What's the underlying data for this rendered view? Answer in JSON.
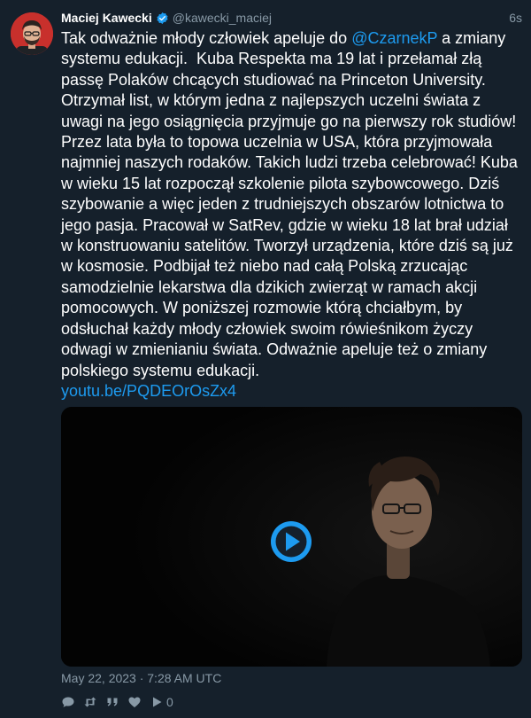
{
  "author": {
    "display_name": "Maciej Kawecki",
    "handle": "@kawecki_maciej",
    "time_ago": "6s",
    "verified": true
  },
  "tweet": {
    "text_before_mention": "Tak odważnie młody człowiek apeluje do ",
    "mention": "@CzarnekP",
    "text_after_mention": " a zmiany systemu edukacji.  Kuba Respekta ma 19 lat i przełamał złą passę Polaków chcących studiować na Princeton University. Otrzymał list, w którym jedna z najlepszych uczelni świata z uwagi na jego osiągnięcia przyjmuje go na pierwszy rok studiów! Przez lata była to topowa uczelnia w USA, która przyjmowała najmniej naszych rodaków. Takich ludzi trzeba celebrować! Kuba w wieku 15 lat rozpoczął szkolenie pilota szybowcowego. Dziś szybowanie a więc jeden z trudniejszych obszarów lotnictwa to jego pasja. Pracował w SatRev, gdzie w wieku 18 lat brał udział w konstruowaniu satelitów. Tworzył urządzenia, które dziś są już w kosmosie. Podbijał też niebo nad całą Polską zrzucając samodzielnie lekarstwa dla dzikich zwierząt w ramach akcji pomocowych. W poniższej rozmowie którą chciałbym, by odsłuchał każdy młody człowiek swoim rówieśnikom życzy odwagi w zmienianiu świata. Odważnie apeluje też o zmiany polskiego systemu edukacji.\n",
    "link": "youtu.be/PQDEOrOsZx4"
  },
  "date": "May 22, 2023 · 7:28 AM UTC",
  "stats": {
    "views": "0"
  },
  "colors": {
    "background": "#15202b",
    "link": "#1d9bf0",
    "muted": "#8899a6",
    "avatar_bg": "#c8302c"
  },
  "icons": {
    "verified": "verified-badge-icon",
    "reply": "reply-icon",
    "retweet": "retweet-icon",
    "quote": "quote-icon",
    "like": "heart-icon",
    "play": "play-icon"
  }
}
